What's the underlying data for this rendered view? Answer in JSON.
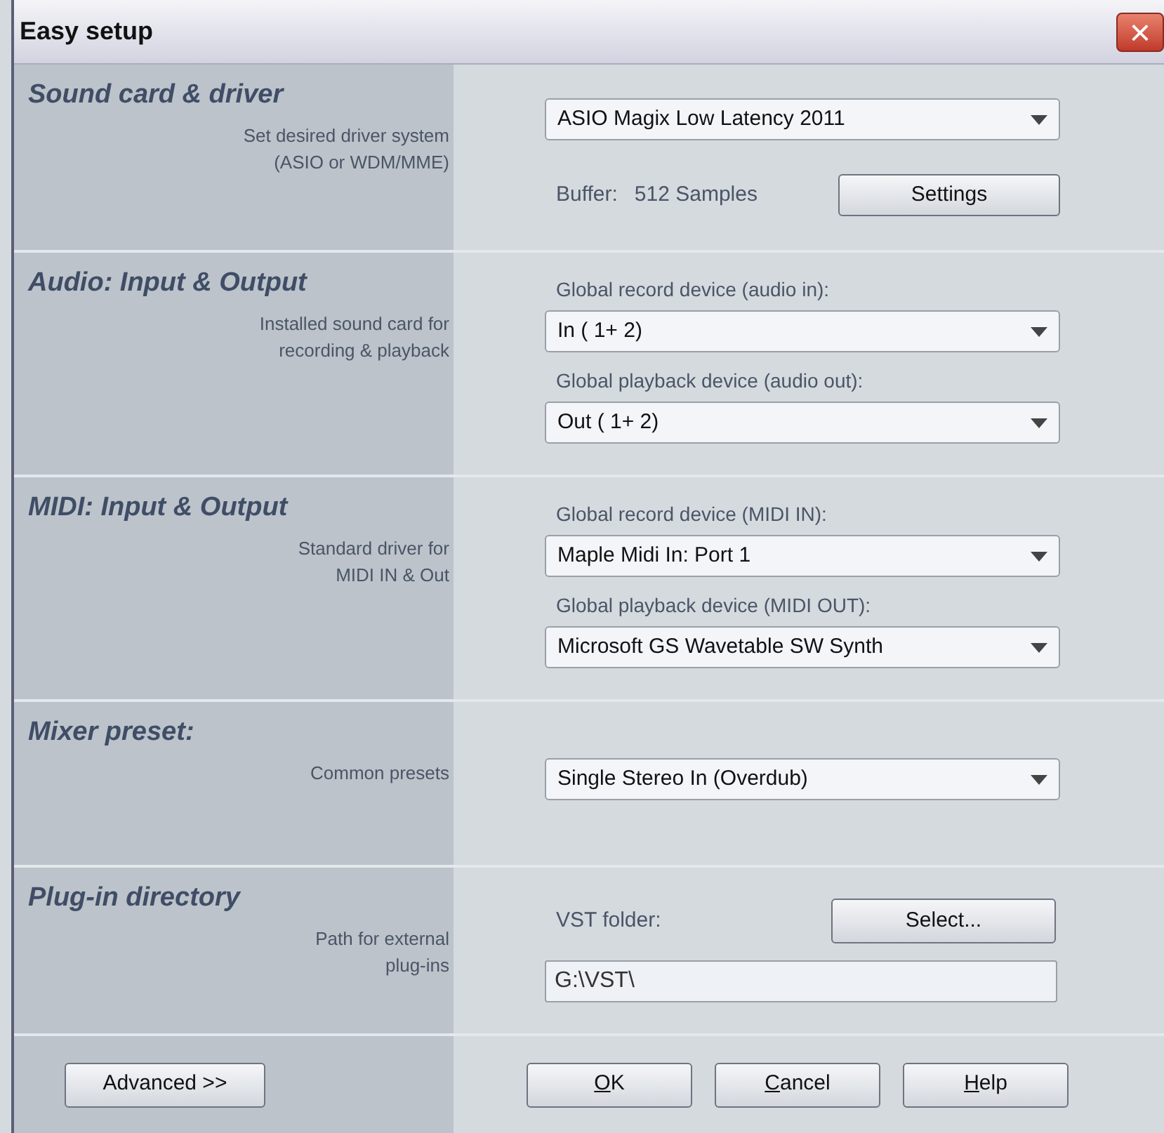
{
  "window": {
    "title": "Easy setup",
    "close_button": "×"
  },
  "sections": [
    {
      "title": "Sound card & driver",
      "description": [
        "Set desired driver system",
        "(ASIO or WDM/MME)"
      ],
      "controls": [
        {
          "kind": "dropdown",
          "value": "ASIO Magix Low Latency 2011"
        },
        {
          "kind": "buffer",
          "label": "Buffer:",
          "value": "512 Samples",
          "button": "Settings"
        }
      ]
    },
    {
      "title": "Audio: Input & Output",
      "description": [
        "Installed sound card for",
        "recording & playback"
      ],
      "controls": [
        {
          "kind": "label",
          "text": "Global record device (audio in):"
        },
        {
          "kind": "dropdown",
          "value": "In ( 1+ 2)"
        },
        {
          "kind": "label",
          "text": "Global playback device (audio out):"
        },
        {
          "kind": "dropdown",
          "value": "Out ( 1+ 2)"
        }
      ]
    },
    {
      "title": "MIDI: Input & Output",
      "description": [
        "Standard driver for",
        "MIDI IN & Out"
      ],
      "controls": [
        {
          "kind": "label",
          "text": "Global record device (MIDI IN):"
        },
        {
          "kind": "dropdown",
          "value": "Maple Midi In: Port 1"
        },
        {
          "kind": "label",
          "text": "Global playback device (MIDI OUT):"
        },
        {
          "kind": "dropdown",
          "value": "Microsoft GS Wavetable SW Synth"
        }
      ]
    },
    {
      "title": "Mixer preset:",
      "description": [
        "Common presets"
      ],
      "controls": [
        {
          "kind": "dropdown",
          "value": "Single Stereo In (Overdub)"
        }
      ]
    },
    {
      "title": "Plug-in directory",
      "description": [
        "Path for external",
        "plug-ins"
      ],
      "controls": [
        {
          "kind": "folder",
          "label": "VST folder:",
          "button": "Select..."
        },
        {
          "kind": "path",
          "value": "G:\\VST\\"
        }
      ]
    }
  ],
  "footer": {
    "advanced_button": "Advanced >>",
    "buttons": [
      {
        "label": "OK",
        "underline_first": true
      },
      {
        "label": "Cancel",
        "underline_first": true
      },
      {
        "label": "Help",
        "underline_first": true
      }
    ]
  }
}
